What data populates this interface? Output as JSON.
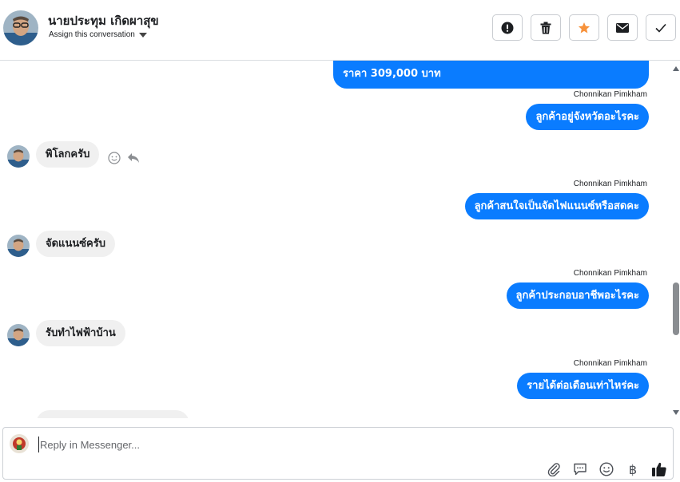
{
  "header": {
    "contact_name": "นายประทุม เกิดผาสุข",
    "assign_label": "Assign this conversation",
    "actions": [
      {
        "icon": "exclamation-icon",
        "name": "mark-spam-button"
      },
      {
        "icon": "trash-icon",
        "name": "delete-button"
      },
      {
        "icon": "star-icon",
        "name": "follow-up-button"
      },
      {
        "icon": "envelope-icon",
        "name": "mark-unread-button"
      },
      {
        "icon": "check-icon",
        "name": "mark-done-button"
      }
    ]
  },
  "colors": {
    "outgoing_bubble": "#0a7cff",
    "incoming_bubble": "#f0f0f0",
    "star": "#f7923b"
  },
  "messages": [
    {
      "direction": "out",
      "text": "ราคา 309,000 บาท",
      "sender": ""
    },
    {
      "direction": "out",
      "text": "ลูกค้าอยู่จังหวัดอะไรคะ",
      "sender": "Chonnikan Pimkham"
    },
    {
      "direction": "in",
      "text": "พิโลกครับ"
    },
    {
      "direction": "out",
      "text": "ลูกค้าสนใจเป็นจัดไฟแนนซ์หรือสดคะ",
      "sender": "Chonnikan Pimkham"
    },
    {
      "direction": "in",
      "text": "จัดแนนซ์ครับ"
    },
    {
      "direction": "out",
      "text": "ลูกค้าประกอบอาชีพอะไรคะ",
      "sender": "Chonnikan Pimkham"
    },
    {
      "direction": "in",
      "text": "รับทำไฟฟ้าบ้าน"
    },
    {
      "direction": "out",
      "text": "รายได้ต่อเดือนเท่าไหร่คะ",
      "sender": "Chonnikan Pimkham"
    }
  ],
  "composer": {
    "placeholder": "Reply in Messenger...",
    "tools": [
      "paperclip-icon",
      "saved-reply-icon",
      "emoji-icon",
      "baht-icon",
      "thumbs-up-icon"
    ],
    "baht_symbol": "฿"
  }
}
